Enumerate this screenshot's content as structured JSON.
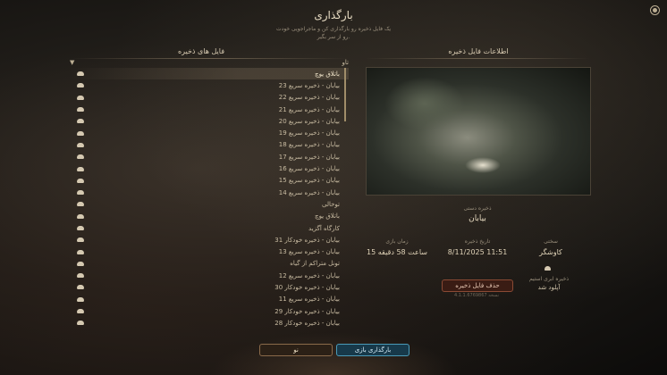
{
  "header": {
    "title": "بارگذاری",
    "subtitle_line1": "یک فایل ذخیره رو بارگذاری کن و ماجراجویی خودت",
    "subtitle_line2": "رو از سر بگیر."
  },
  "left_panel": {
    "title": "فایل های ذخیره",
    "group_label": "تاو",
    "items": [
      "باتلاق یوچ",
      "بیابان - ذخیره سریع 23",
      "بیابان - ذخیره سریع 22",
      "بیابان - ذخیره سریع 21",
      "بیابان - ذخیره سریع 20",
      "بیابان - ذخیره سریع 19",
      "بیابان - ذخیره سریع 18",
      "بیابان - ذخیره سریع 17",
      "بیابان - ذخیره سریع 16",
      "بیابان - ذخیره سریع 15",
      "بیابان - ذخیره سریع 14",
      "توخالی",
      "باتلاق یوچ",
      "کارگاه آگزید",
      "بیابان - ذخیره خودکار 31",
      "بیابان - ذخیره سریع 13",
      "تونل متراکم از گیاه",
      "بیابان - ذخیره سریع 12",
      "بیابان - ذخیره خودکار 30",
      "بیابان - ذخیره سریع 11",
      "بیابان - ذخیره خودکار 29",
      "بیابان - ذخیره خودکار 28"
    ]
  },
  "right_panel": {
    "title": "اطلاعات فایل ذخیره",
    "save_type": "ذخیره دستی",
    "save_name": "بیابان",
    "difficulty_label": "سختی",
    "difficulty_value": "کاوشگر",
    "date_label": "تاریخ ذخیره",
    "date_value": "8/11/2025 11:51",
    "playtime_label": "زمان بازی",
    "playtime_value": "15 ساعت 58 دقیقه",
    "cloud_label": "ذخیره ابری استیم",
    "cloud_value": "آپلود شد",
    "delete_label": "حذف فایل ذخیره",
    "version": "نسخه 4.1.1.6769867"
  },
  "footer": {
    "new_label": "نو",
    "load_label": "بارگذاری بازی"
  },
  "colors": {
    "accent_blue": "#4a9ab8",
    "delete_red": "#8a4a34",
    "text_gold": "#d9cdb6"
  }
}
